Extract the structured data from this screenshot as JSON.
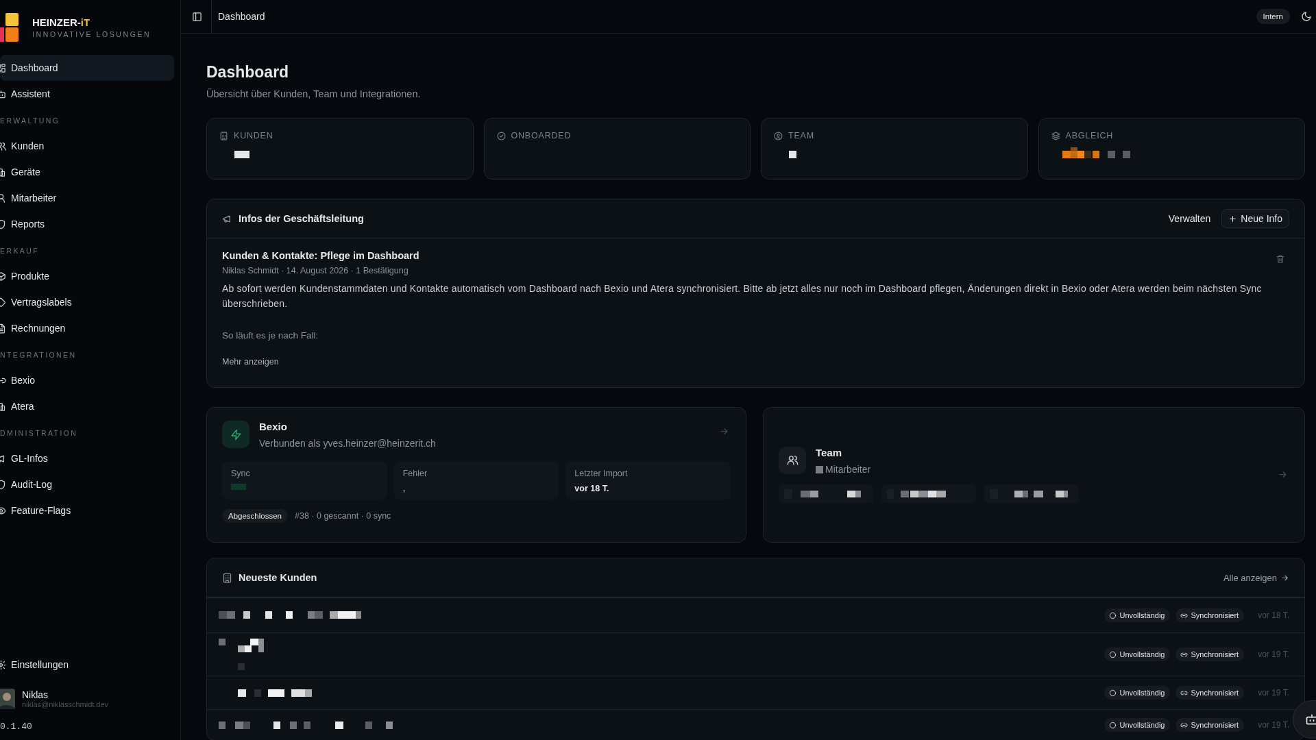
{
  "brand": {
    "name": "HEINZER-",
    "accent": "iT",
    "tagline": "INNOVATIVE LÖSUNGEN"
  },
  "nav": [
    {
      "kind": "item",
      "label": "Dashboard",
      "selected": true
    },
    {
      "kind": "item",
      "label": "Assistent",
      "selected": false
    },
    {
      "kind": "section",
      "label": "ERWALTUNG"
    },
    {
      "kind": "item",
      "label": "Kunden",
      "selected": false
    },
    {
      "kind": "item",
      "label": "Geräte",
      "selected": false
    },
    {
      "kind": "item",
      "label": "Mitarbeiter",
      "selected": false
    },
    {
      "kind": "item",
      "label": "Reports",
      "selected": false
    },
    {
      "kind": "section",
      "label": "ERKAUF"
    },
    {
      "kind": "item",
      "label": "Produkte",
      "selected": false
    },
    {
      "kind": "item",
      "label": "Vertragslabels",
      "selected": false
    },
    {
      "kind": "item",
      "label": "Rechnungen",
      "selected": false
    },
    {
      "kind": "section",
      "label": "NTEGRATIONEN"
    },
    {
      "kind": "item",
      "label": "Bexio",
      "selected": false
    },
    {
      "kind": "item",
      "label": "Atera",
      "selected": false
    },
    {
      "kind": "section",
      "label": "DMINISTRATION"
    },
    {
      "kind": "item",
      "label": "GL-Infos",
      "selected": false
    },
    {
      "kind": "item",
      "label": "Audit-Log",
      "selected": false
    },
    {
      "kind": "item",
      "label": "Feature-Flags",
      "selected": false
    }
  ],
  "settings": "Einstellungen",
  "user": {
    "name": "Niklas",
    "email": "niklas@niklasschmidt.dev"
  },
  "version": "0.1.40",
  "topbar": {
    "title": "Dashboard",
    "badge": "Intern"
  },
  "page": {
    "title": "Dashboard",
    "subtitle": "Übersicht über Kunden, Team und Integrationen."
  },
  "stats": [
    {
      "label": "KUNDEN"
    },
    {
      "label": "ONBOARDED"
    },
    {
      "label": "TEAM"
    },
    {
      "label": "ABGLEICH"
    }
  ],
  "info": {
    "title": "Infos der Geschäftsleitung",
    "manage": "Verwalten",
    "add": "Neue Info",
    "post": {
      "title": "Kunden & Kontakte: Pflege im Dashboard",
      "meta": "Niklas Schmidt · 14. August 2026 · 1 Bestätigung",
      "body": "Ab sofort werden Kundenstammdaten und Kontakte automatisch vom Dashboard nach Bexio und Atera synchronisiert. Bitte ab jetzt alles nur noch im Dashboard pflegen, Änderungen direkt in Bexio oder Atera werden beim nächsten Sync überschrieben.",
      "body2": "So läuft es je nach Fall:",
      "more": "Mehr anzeigen"
    }
  },
  "bexio": {
    "title": "Bexio",
    "subtitle": "Verbunden als yves.heinzer@heinzerit.ch",
    "fields": [
      {
        "label": "Sync"
      },
      {
        "label": "Fehler",
        "value": ","
      },
      {
        "label": "Letzter Import",
        "value": "vor 18 T."
      }
    ],
    "status": "Abgeschlossen",
    "summary": "#38 · 0 gescannt · 0 sync"
  },
  "team": {
    "title": "Team",
    "subtitle": "Mitarbeiter"
  },
  "customers": {
    "title": "Neueste Kunden",
    "link": "Alle anzeigen",
    "rows": [
      {
        "status": "Unvollständig",
        "sync": "Synchronisiert",
        "age": "vor 18 T."
      },
      {
        "status": "Unvollständig",
        "sync": "Synchronisiert",
        "age": "vor 19 T."
      },
      {
        "status": "Unvollständig",
        "sync": "Synchronisiert",
        "age": "vor 19 T."
      },
      {
        "status": "Unvollständig",
        "sync": "Synchronisiert",
        "age": "vor 19 T."
      }
    ]
  }
}
